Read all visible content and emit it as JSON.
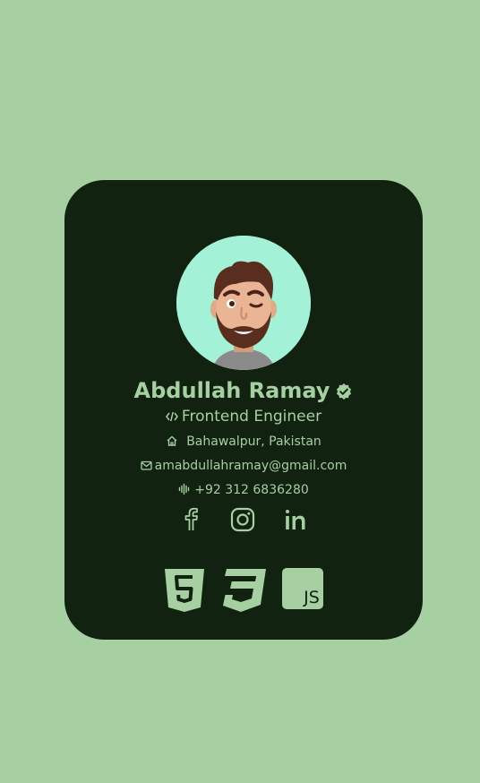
{
  "profile": {
    "name": "Abdullah Ramay",
    "role": "Frontend Engineer",
    "location": "Bahawalpur, Pakistan",
    "email": "amabdullahramay@gmail.com",
    "phone": "+92 312 6836280"
  },
  "socials": [
    "facebook-icon",
    "instagram-icon",
    "linkedin-icon"
  ],
  "tech": [
    "html5-icon",
    "css3-icon"
  ],
  "tech_js_label": "JS",
  "colors": {
    "background": "#a6cfa2",
    "card": "#112211",
    "accent": "#a6cfa2",
    "avatar_bg": "#a3f2d7"
  }
}
